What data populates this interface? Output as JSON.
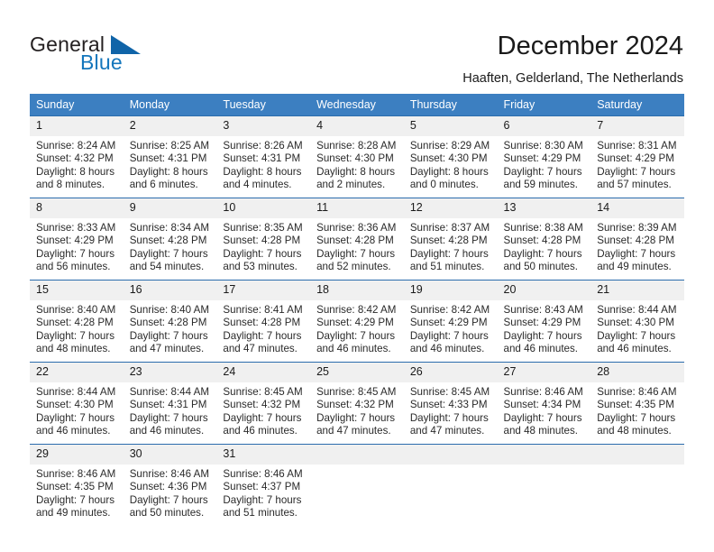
{
  "brand": {
    "name_part1": "General",
    "name_part2": "Blue",
    "accent_color": "#1064a8",
    "blue_text_color": "#1476bc"
  },
  "header": {
    "title": "December 2024",
    "location": "Haaften, Gelderland, The Netherlands"
  },
  "calendar": {
    "header_bg": "#3c7fc1",
    "day_band_bg": "#f0f0f0",
    "row_border_color": "#2b6cad",
    "weekday_headers": [
      "Sunday",
      "Monday",
      "Tuesday",
      "Wednesday",
      "Thursday",
      "Friday",
      "Saturday"
    ],
    "weeks": [
      [
        {
          "day": "1",
          "sunrise": "Sunrise: 8:24 AM",
          "sunset": "Sunset: 4:32 PM",
          "daylight_line1": "Daylight: 8 hours",
          "daylight_line2": "and 8 minutes."
        },
        {
          "day": "2",
          "sunrise": "Sunrise: 8:25 AM",
          "sunset": "Sunset: 4:31 PM",
          "daylight_line1": "Daylight: 8 hours",
          "daylight_line2": "and 6 minutes."
        },
        {
          "day": "3",
          "sunrise": "Sunrise: 8:26 AM",
          "sunset": "Sunset: 4:31 PM",
          "daylight_line1": "Daylight: 8 hours",
          "daylight_line2": "and 4 minutes."
        },
        {
          "day": "4",
          "sunrise": "Sunrise: 8:28 AM",
          "sunset": "Sunset: 4:30 PM",
          "daylight_line1": "Daylight: 8 hours",
          "daylight_line2": "and 2 minutes."
        },
        {
          "day": "5",
          "sunrise": "Sunrise: 8:29 AM",
          "sunset": "Sunset: 4:30 PM",
          "daylight_line1": "Daylight: 8 hours",
          "daylight_line2": "and 0 minutes."
        },
        {
          "day": "6",
          "sunrise": "Sunrise: 8:30 AM",
          "sunset": "Sunset: 4:29 PM",
          "daylight_line1": "Daylight: 7 hours",
          "daylight_line2": "and 59 minutes."
        },
        {
          "day": "7",
          "sunrise": "Sunrise: 8:31 AM",
          "sunset": "Sunset: 4:29 PM",
          "daylight_line1": "Daylight: 7 hours",
          "daylight_line2": "and 57 minutes."
        }
      ],
      [
        {
          "day": "8",
          "sunrise": "Sunrise: 8:33 AM",
          "sunset": "Sunset: 4:29 PM",
          "daylight_line1": "Daylight: 7 hours",
          "daylight_line2": "and 56 minutes."
        },
        {
          "day": "9",
          "sunrise": "Sunrise: 8:34 AM",
          "sunset": "Sunset: 4:28 PM",
          "daylight_line1": "Daylight: 7 hours",
          "daylight_line2": "and 54 minutes."
        },
        {
          "day": "10",
          "sunrise": "Sunrise: 8:35 AM",
          "sunset": "Sunset: 4:28 PM",
          "daylight_line1": "Daylight: 7 hours",
          "daylight_line2": "and 53 minutes."
        },
        {
          "day": "11",
          "sunrise": "Sunrise: 8:36 AM",
          "sunset": "Sunset: 4:28 PM",
          "daylight_line1": "Daylight: 7 hours",
          "daylight_line2": "and 52 minutes."
        },
        {
          "day": "12",
          "sunrise": "Sunrise: 8:37 AM",
          "sunset": "Sunset: 4:28 PM",
          "daylight_line1": "Daylight: 7 hours",
          "daylight_line2": "and 51 minutes."
        },
        {
          "day": "13",
          "sunrise": "Sunrise: 8:38 AM",
          "sunset": "Sunset: 4:28 PM",
          "daylight_line1": "Daylight: 7 hours",
          "daylight_line2": "and 50 minutes."
        },
        {
          "day": "14",
          "sunrise": "Sunrise: 8:39 AM",
          "sunset": "Sunset: 4:28 PM",
          "daylight_line1": "Daylight: 7 hours",
          "daylight_line2": "and 49 minutes."
        }
      ],
      [
        {
          "day": "15",
          "sunrise": "Sunrise: 8:40 AM",
          "sunset": "Sunset: 4:28 PM",
          "daylight_line1": "Daylight: 7 hours",
          "daylight_line2": "and 48 minutes."
        },
        {
          "day": "16",
          "sunrise": "Sunrise: 8:40 AM",
          "sunset": "Sunset: 4:28 PM",
          "daylight_line1": "Daylight: 7 hours",
          "daylight_line2": "and 47 minutes."
        },
        {
          "day": "17",
          "sunrise": "Sunrise: 8:41 AM",
          "sunset": "Sunset: 4:28 PM",
          "daylight_line1": "Daylight: 7 hours",
          "daylight_line2": "and 47 minutes."
        },
        {
          "day": "18",
          "sunrise": "Sunrise: 8:42 AM",
          "sunset": "Sunset: 4:29 PM",
          "daylight_line1": "Daylight: 7 hours",
          "daylight_line2": "and 46 minutes."
        },
        {
          "day": "19",
          "sunrise": "Sunrise: 8:42 AM",
          "sunset": "Sunset: 4:29 PM",
          "daylight_line1": "Daylight: 7 hours",
          "daylight_line2": "and 46 minutes."
        },
        {
          "day": "20",
          "sunrise": "Sunrise: 8:43 AM",
          "sunset": "Sunset: 4:29 PM",
          "daylight_line1": "Daylight: 7 hours",
          "daylight_line2": "and 46 minutes."
        },
        {
          "day": "21",
          "sunrise": "Sunrise: 8:44 AM",
          "sunset": "Sunset: 4:30 PM",
          "daylight_line1": "Daylight: 7 hours",
          "daylight_line2": "and 46 minutes."
        }
      ],
      [
        {
          "day": "22",
          "sunrise": "Sunrise: 8:44 AM",
          "sunset": "Sunset: 4:30 PM",
          "daylight_line1": "Daylight: 7 hours",
          "daylight_line2": "and 46 minutes."
        },
        {
          "day": "23",
          "sunrise": "Sunrise: 8:44 AM",
          "sunset": "Sunset: 4:31 PM",
          "daylight_line1": "Daylight: 7 hours",
          "daylight_line2": "and 46 minutes."
        },
        {
          "day": "24",
          "sunrise": "Sunrise: 8:45 AM",
          "sunset": "Sunset: 4:32 PM",
          "daylight_line1": "Daylight: 7 hours",
          "daylight_line2": "and 46 minutes."
        },
        {
          "day": "25",
          "sunrise": "Sunrise: 8:45 AM",
          "sunset": "Sunset: 4:32 PM",
          "daylight_line1": "Daylight: 7 hours",
          "daylight_line2": "and 47 minutes."
        },
        {
          "day": "26",
          "sunrise": "Sunrise: 8:45 AM",
          "sunset": "Sunset: 4:33 PM",
          "daylight_line1": "Daylight: 7 hours",
          "daylight_line2": "and 47 minutes."
        },
        {
          "day": "27",
          "sunrise": "Sunrise: 8:46 AM",
          "sunset": "Sunset: 4:34 PM",
          "daylight_line1": "Daylight: 7 hours",
          "daylight_line2": "and 48 minutes."
        },
        {
          "day": "28",
          "sunrise": "Sunrise: 8:46 AM",
          "sunset": "Sunset: 4:35 PM",
          "daylight_line1": "Daylight: 7 hours",
          "daylight_line2": "and 48 minutes."
        }
      ],
      [
        {
          "day": "29",
          "sunrise": "Sunrise: 8:46 AM",
          "sunset": "Sunset: 4:35 PM",
          "daylight_line1": "Daylight: 7 hours",
          "daylight_line2": "and 49 minutes."
        },
        {
          "day": "30",
          "sunrise": "Sunrise: 8:46 AM",
          "sunset": "Sunset: 4:36 PM",
          "daylight_line1": "Daylight: 7 hours",
          "daylight_line2": "and 50 minutes."
        },
        {
          "day": "31",
          "sunrise": "Sunrise: 8:46 AM",
          "sunset": "Sunset: 4:37 PM",
          "daylight_line1": "Daylight: 7 hours",
          "daylight_line2": "and 51 minutes."
        },
        {
          "day": "",
          "sunrise": "",
          "sunset": "",
          "daylight_line1": "",
          "daylight_line2": ""
        },
        {
          "day": "",
          "sunrise": "",
          "sunset": "",
          "daylight_line1": "",
          "daylight_line2": ""
        },
        {
          "day": "",
          "sunrise": "",
          "sunset": "",
          "daylight_line1": "",
          "daylight_line2": ""
        },
        {
          "day": "",
          "sunrise": "",
          "sunset": "",
          "daylight_line1": "",
          "daylight_line2": ""
        }
      ]
    ]
  }
}
